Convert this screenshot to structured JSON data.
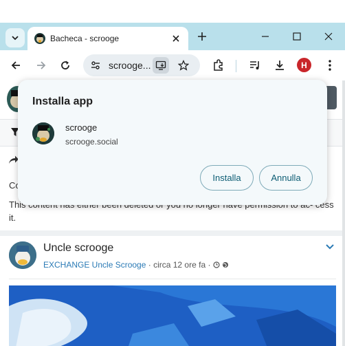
{
  "browser": {
    "tab_title": "Bacheca - scrooge",
    "address_text": "scrooge...",
    "extension_badge": "H"
  },
  "popup": {
    "title": "Installa app",
    "app_name": "scrooge",
    "app_url": "scrooge.social",
    "install_label": "Installa",
    "cancel_label": "Annulla"
  },
  "feed": {
    "partial_text": "Co",
    "deleted_message": "This content has either been deleted or you no longer have permission to ac- cess it.",
    "post": {
      "author": "Uncle scrooge",
      "group_link": "EXCHANGE Uncle Scrooge",
      "time": "circa 12 ore fa"
    }
  },
  "colors": {
    "titlebar": "#b9e0eb",
    "accent_link": "#2a7ab5",
    "popup_button_text": "#0b5c73",
    "extension_red": "#c9262b"
  },
  "icons": [
    "tab-search-icon",
    "close-icon",
    "plus-icon",
    "minimize-icon",
    "maximize-icon",
    "window-close-icon",
    "back-icon",
    "forward-icon",
    "reload-icon",
    "site-info-icon",
    "install-app-icon",
    "star-icon",
    "extensions-icon",
    "media-icon",
    "download-icon",
    "menu-icon",
    "filter-icon",
    "share-icon",
    "chevron-down-icon",
    "clock-icon",
    "globe-icon"
  ]
}
